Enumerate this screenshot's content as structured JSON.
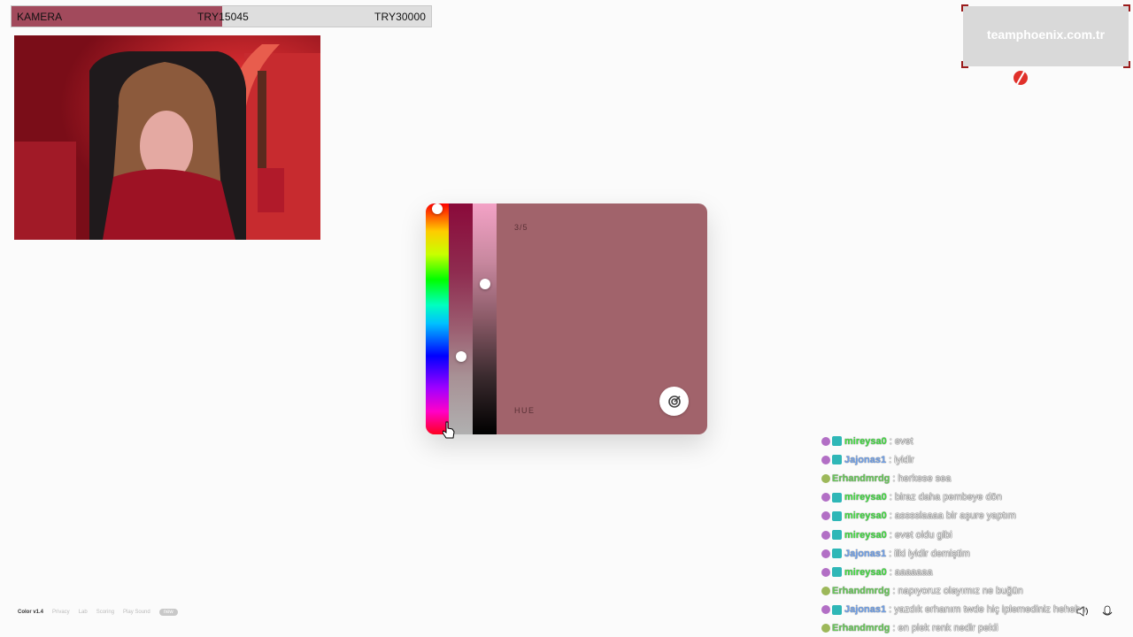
{
  "donation": {
    "label": "KAMERA",
    "current": "TRY15045",
    "goal": "TRY30000",
    "progress": 0.5015,
    "fill_color": "#a24a5c"
  },
  "sponsor": {
    "text": "teamphoenix.com.tr",
    "logo_icon": "phoenix-logo-icon"
  },
  "picker": {
    "step": "3/5",
    "mode": "HUE",
    "swatch_color": "#a1636b",
    "submit_icon": "target-icon",
    "hue_level": 0.98,
    "saturation_level": 0.67,
    "lightness_level": 0.34
  },
  "footer": {
    "brand": "Color v1.4",
    "links": [
      "Privacy",
      "Lab",
      "Scoring",
      "Play Sound"
    ],
    "badge": "new"
  },
  "chat": {
    "messages": [
      {
        "user": "mireysa0",
        "text": ": evet",
        "badges": [
          "purple",
          "teal"
        ],
        "color": "green"
      },
      {
        "user": "Jajonas1",
        "text": ": iyidir",
        "badges": [
          "purple",
          "teal"
        ],
        "color": "blue"
      },
      {
        "user": "Erhandmrdg",
        "text": ": herkese sea",
        "badges": [
          "green"
        ],
        "color": "green2"
      },
      {
        "user": "mireysa0",
        "text": ": biraz daha pembeye dön",
        "badges": [
          "purple",
          "teal"
        ],
        "color": "green"
      },
      {
        "user": "mireysa0",
        "text": ": asssslaaaa bir aşure yaptım",
        "badges": [
          "purple",
          "teal"
        ],
        "color": "green"
      },
      {
        "user": "mireysa0",
        "text": ": evet oldu gibi",
        "badges": [
          "purple",
          "teal"
        ],
        "color": "green"
      },
      {
        "user": "Jajonas1",
        "text": ": ilki iyidir demiştim",
        "badges": [
          "purple",
          "teal"
        ],
        "color": "blue"
      },
      {
        "user": "mireysa0",
        "text": ": aaaaaaa",
        "badges": [
          "purple",
          "teal"
        ],
        "color": "green"
      },
      {
        "user": "Erhandmrdg",
        "text": ": napıyoruz olayımız ne buğün",
        "badges": [
          "green"
        ],
        "color": "green2"
      },
      {
        "user": "Jajonas1",
        "text": ": yazdık erhanım twde hiç iplemediniz hehehe",
        "badges": [
          "purple",
          "teal"
        ],
        "color": "blue"
      },
      {
        "user": "Erhandmrdg",
        "text": ": en plek renk nedir pekii",
        "badges": [
          "green"
        ],
        "color": "green2"
      }
    ]
  }
}
